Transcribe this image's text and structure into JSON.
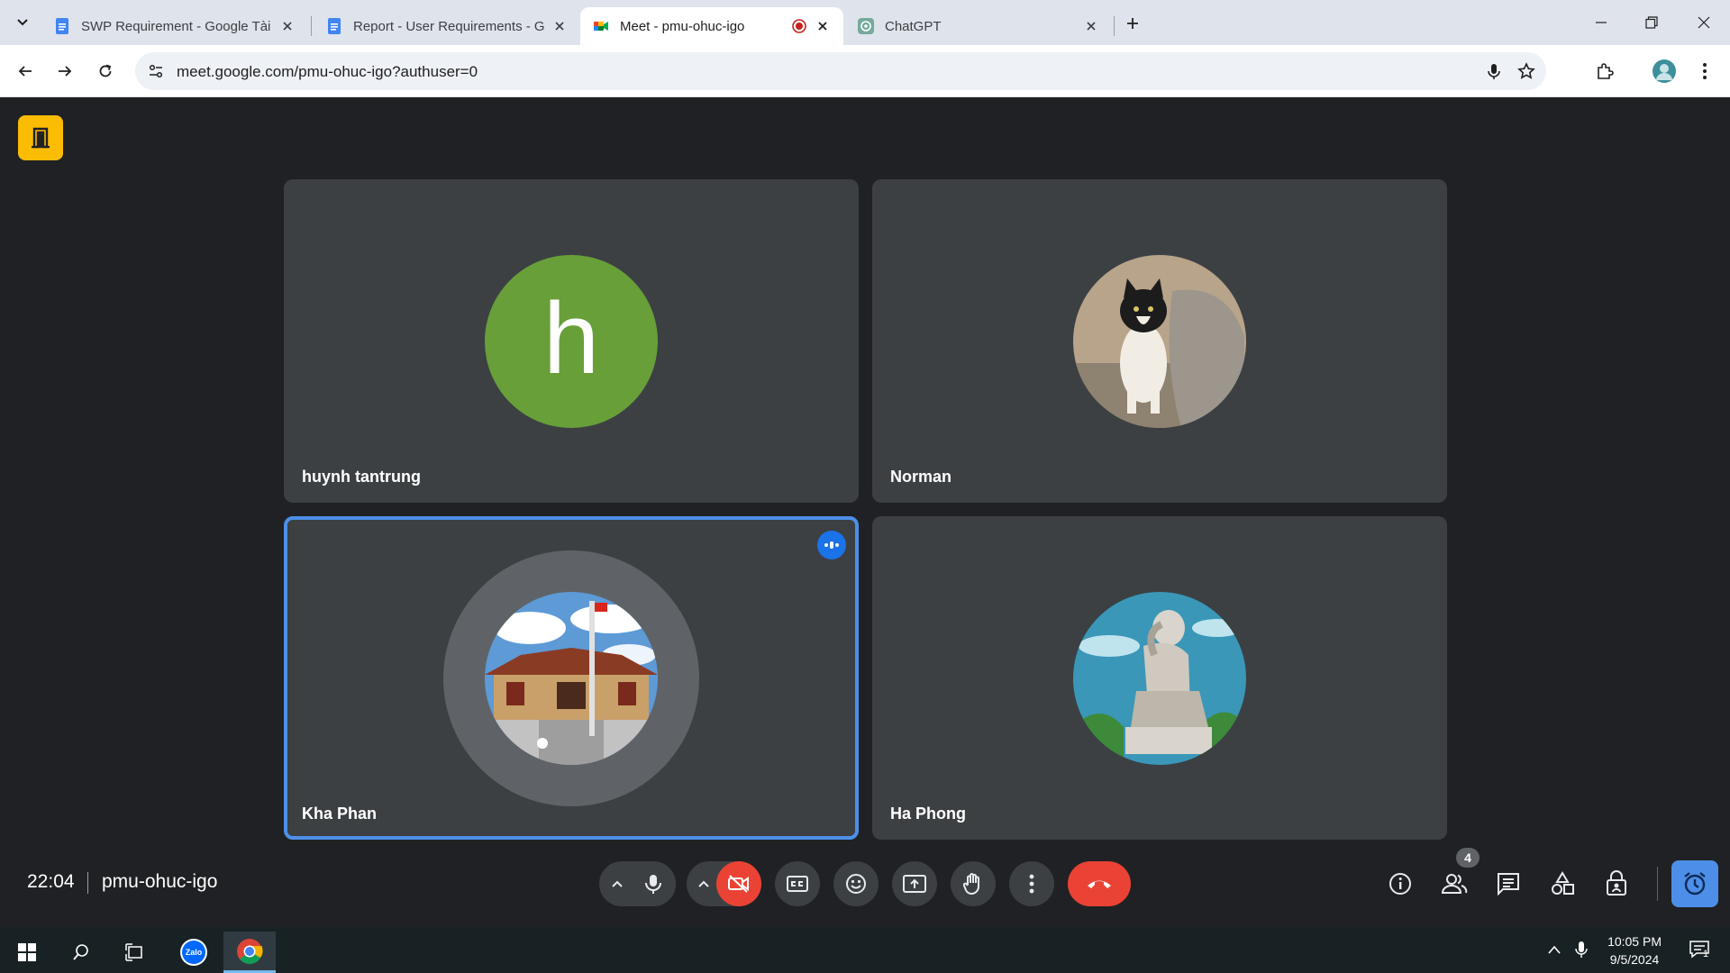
{
  "browser": {
    "tabs": [
      {
        "title": "SWP Requirement - Google Tài",
        "favicon": "google-docs-icon",
        "active": false
      },
      {
        "title": "Report - User Requirements - G",
        "favicon": "google-docs-icon",
        "active": false
      },
      {
        "title": "Meet - pmu-ohuc-igo",
        "favicon": "google-meet-icon",
        "active": true,
        "recording": true
      },
      {
        "title": "ChatGPT",
        "favicon": "chatgpt-icon",
        "active": false
      }
    ],
    "url": "meet.google.com/pmu-ohuc-igo?authuser=0"
  },
  "meeting": {
    "participants": [
      {
        "name": "huynh tantrung",
        "avatar_letter": "h",
        "avatar_color": "#689f38",
        "speaking": false
      },
      {
        "name": "Norman",
        "avatar_image": "cat-photo",
        "speaking": false
      },
      {
        "name": "Kha Phan",
        "avatar_image": "temple-photo",
        "speaking": true
      },
      {
        "name": "Ha Phong",
        "avatar_image": "thinker-statue-photo",
        "speaking": false
      }
    ],
    "clock": "22:04",
    "code": "pmu-ohuc-igo",
    "people_count": "4"
  },
  "taskbar": {
    "time": "10:05 PM",
    "date": "9/5/2024",
    "notification_count": "1",
    "zalo_label": "Zalo"
  },
  "colors": {
    "accent": "#4d8fe8",
    "end_call": "#ea4335",
    "camera_off": "#ea4335",
    "stage_bg": "#202124",
    "tile_bg": "#3c4043"
  }
}
